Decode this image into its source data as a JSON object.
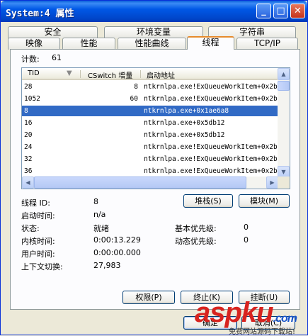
{
  "window": {
    "title": "System:4 属性"
  },
  "titlebar": {
    "minimize": "_",
    "maximize": "□",
    "close": "✕"
  },
  "tabs": {
    "row1": [
      {
        "label": "安全"
      },
      {
        "label": "环境变量"
      },
      {
        "label": "字符串"
      }
    ],
    "row2": [
      {
        "label": "映像"
      },
      {
        "label": "性能"
      },
      {
        "label": "性能曲线"
      },
      {
        "label": "线程",
        "active": true
      },
      {
        "label": "TCP/IP"
      }
    ]
  },
  "thread_count": {
    "label": "计数:",
    "value": "61"
  },
  "thread_list": {
    "columns": [
      "TID",
      "CSwitch 增量",
      "启动地址"
    ],
    "rows": [
      {
        "tid": "28",
        "cswitch": "8",
        "address": "ntkrnlpa.exe!ExQueueWorkItem+0x2b"
      },
      {
        "tid": "1052",
        "cswitch": "60",
        "address": "ntkrnlpa.exe!ExQueueWorkItem+0x2b"
      },
      {
        "tid": "8",
        "cswitch": "",
        "address": "ntkrnlpa.exe+0x1ae6a8"
      },
      {
        "tid": "16",
        "cswitch": "",
        "address": "ntkrnlpa.exe+0x5db12"
      },
      {
        "tid": "20",
        "cswitch": "",
        "address": "ntkrnlpa.exe+0x5db12"
      },
      {
        "tid": "24",
        "cswitch": "",
        "address": "ntkrnlpa.exe!ExQueueWorkItem+0x2b"
      },
      {
        "tid": "32",
        "cswitch": "",
        "address": "ntkrnlpa.exe!ExQueueWorkItem+0x2b"
      },
      {
        "tid": "36",
        "cswitch": "",
        "address": "ntkrnlpa.exe!ExQueueWorkItem+0x2b"
      }
    ],
    "selected_tid": "8"
  },
  "details": {
    "thread_id": {
      "label": "线程 ID:",
      "value": "8"
    },
    "start_time": {
      "label": "启动时间:",
      "value": "n/a"
    },
    "state": {
      "label": "状态:",
      "value": "就绪"
    },
    "kernel_time": {
      "label": "内核时间:",
      "value": "0:00:13.229"
    },
    "user_time": {
      "label": "用户时间:",
      "value": "0:00:00.000"
    },
    "context_switches": {
      "label": "上下文切换:",
      "value": "27,983"
    },
    "base_priority": {
      "label": "基本优先级:",
      "value": "0"
    },
    "dynamic_priority": {
      "label": "动态优先级:",
      "value": "0"
    }
  },
  "buttons": {
    "stack": "堆栈(S)",
    "module": "模块(M)",
    "permissions": "权限(P)",
    "kill": "终止(K)",
    "suspend": "挂断(U)",
    "ok": "确定",
    "cancel": "取消(C)"
  },
  "watermark": {
    "brand": "aspku",
    "tld": ".com",
    "tagline": "免费网站源码下载站!"
  },
  "colors": {
    "titlebar": "#0058e6",
    "selection": "#316ac5",
    "active_tab_accent": "#e68b2c",
    "watermark_red": "#d8231f",
    "watermark_blue": "#1a56c8"
  }
}
